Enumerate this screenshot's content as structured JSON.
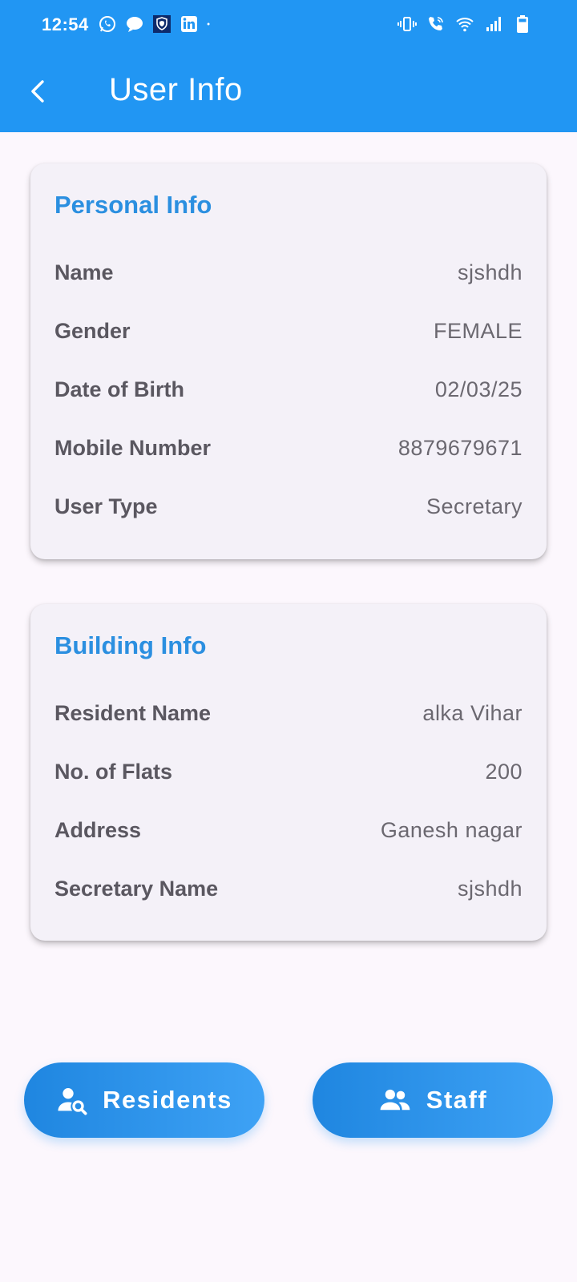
{
  "status_bar": {
    "time": "12:54",
    "left_icons": [
      "whatsapp-icon",
      "message-icon",
      "shield-app-icon",
      "linkedin-icon",
      "dot-icon"
    ],
    "right_icons": [
      "vibrate-icon",
      "wifi-call-icon",
      "wifi-icon",
      "signal-icon",
      "battery-icon"
    ]
  },
  "app_bar": {
    "title": "User Info",
    "back_icon": "chevron-left-icon"
  },
  "personal_info": {
    "title": "Personal Info",
    "rows": [
      {
        "label": "Name",
        "value": "sjshdh"
      },
      {
        "label": "Gender",
        "value": "FEMALE"
      },
      {
        "label": "Date of Birth",
        "value": "02/03/25"
      },
      {
        "label": "Mobile Number",
        "value": "8879679671"
      },
      {
        "label": "User Type",
        "value": "Secretary"
      }
    ]
  },
  "building_info": {
    "title": "Building Info",
    "rows": [
      {
        "label": "Resident Name",
        "value": "alka Vihar"
      },
      {
        "label": "No. of Flats",
        "value": "200"
      },
      {
        "label": "Address",
        "value": "Ganesh nagar"
      },
      {
        "label": "Secretary Name",
        "value": "sjshdh"
      }
    ]
  },
  "actions": {
    "residents_label": "Residents",
    "residents_icon": "person-search-icon",
    "staff_label": "Staff",
    "staff_icon": "group-icon"
  },
  "colors": {
    "primary": "#2196f3",
    "card_title": "#2b8fe0",
    "background": "#fcf7fd",
    "card": "#f4f1f8"
  }
}
